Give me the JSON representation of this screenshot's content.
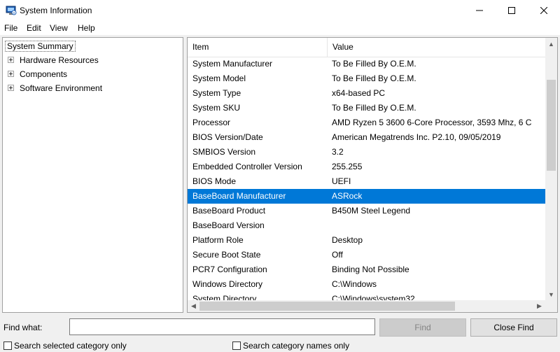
{
  "window": {
    "title": "System Information",
    "controls": {
      "minimize": "—",
      "maximize": "☐",
      "close": "✕"
    }
  },
  "menu": [
    "File",
    "Edit",
    "View",
    "Help"
  ],
  "tree": {
    "root": "System Summary",
    "children": [
      "Hardware Resources",
      "Components",
      "Software Environment"
    ]
  },
  "table": {
    "columns": [
      "Item",
      "Value"
    ],
    "selected_index": 9,
    "rows": [
      {
        "item": "System Manufacturer",
        "value": "To Be Filled By O.E.M."
      },
      {
        "item": "System Model",
        "value": "To Be Filled By O.E.M."
      },
      {
        "item": "System Type",
        "value": "x64-based PC"
      },
      {
        "item": "System SKU",
        "value": "To Be Filled By O.E.M."
      },
      {
        "item": "Processor",
        "value": "AMD Ryzen 5 3600 6-Core Processor, 3593 Mhz, 6 C"
      },
      {
        "item": "BIOS Version/Date",
        "value": "American Megatrends Inc. P2.10, 09/05/2019"
      },
      {
        "item": "SMBIOS Version",
        "value": "3.2"
      },
      {
        "item": "Embedded Controller Version",
        "value": "255.255"
      },
      {
        "item": "BIOS Mode",
        "value": "UEFI"
      },
      {
        "item": "BaseBoard Manufacturer",
        "value": "ASRock"
      },
      {
        "item": "BaseBoard Product",
        "value": "B450M Steel Legend"
      },
      {
        "item": "BaseBoard Version",
        "value": ""
      },
      {
        "item": "Platform Role",
        "value": "Desktop"
      },
      {
        "item": "Secure Boot State",
        "value": "Off"
      },
      {
        "item": "PCR7 Configuration",
        "value": "Binding Not Possible"
      },
      {
        "item": "Windows Directory",
        "value": "C:\\Windows"
      },
      {
        "item": "System Directory",
        "value": "C:\\Windows\\system32"
      }
    ]
  },
  "find": {
    "label": "Find what:",
    "value": "",
    "find_button": "Find",
    "close_button": "Close Find",
    "search_selected": "Search selected category only",
    "search_names": "Search category names only"
  },
  "colors": {
    "selection": "#0078d7",
    "accent_icon": "#1e5fb4"
  }
}
